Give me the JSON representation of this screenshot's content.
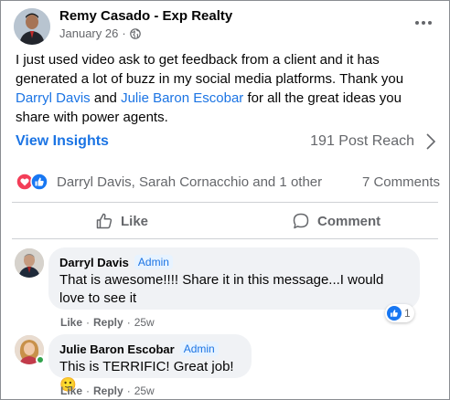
{
  "post": {
    "author": "Remy Casado - Exp Realty",
    "date": "January 26",
    "separator": "·",
    "privacy_icon": "globe-icon",
    "text_part1": "I just used video ask to get feedback from a client and it has generated a lot of buzz in my social media platforms. Thank you ",
    "mention1": "Darryl Davis",
    "text_part2": " and ",
    "mention2": "Julie Baron Escobar",
    "text_part3": " for all the great ideas you share with power agents."
  },
  "insights": {
    "link_label": "View Insights",
    "reach": "191 Post Reach"
  },
  "reactions": {
    "icons": [
      "love-icon",
      "like-icon"
    ],
    "names": "Darryl Davis, Sarah Cornacchio and 1 other",
    "comments": "7 Comments"
  },
  "actions": {
    "like": "Like",
    "comment": "Comment"
  },
  "comments": [
    {
      "name": "Darryl Davis",
      "badge": "Admin",
      "text": "That is awesome!!!! Share it in this message...I would love to see it",
      "like": "Like",
      "reply": "Reply",
      "sep": "·",
      "time": "25w",
      "reaction_count": "1"
    },
    {
      "name": "Julie Baron Escobar",
      "badge": "Admin",
      "text": "This is TERRIFIC! Great job!",
      "emoji": "🙂",
      "like": "Like",
      "reply": "Reply",
      "sep": "·",
      "time": "25w"
    }
  ],
  "colors": {
    "accent": "#1b74e4",
    "secondary_text": "#65676b",
    "bubble": "#f0f2f5",
    "love": "#f33e58",
    "online": "#31a24c"
  }
}
